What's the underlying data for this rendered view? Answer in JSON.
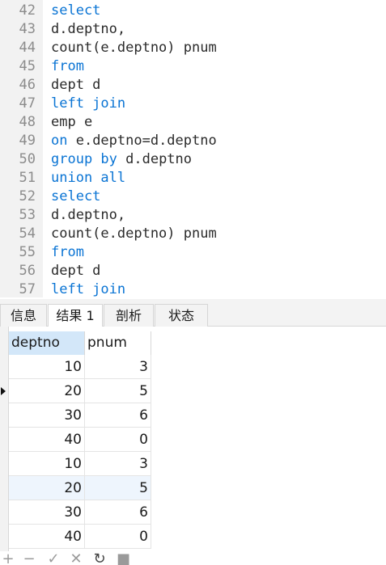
{
  "editor": {
    "lines": [
      {
        "num": "42",
        "text": "select",
        "kind": "kw"
      },
      {
        "num": "43",
        "text": "d.deptno,",
        "kind": "tx"
      },
      {
        "num": "44",
        "text": "count(e.deptno) pnum",
        "kind": "tx"
      },
      {
        "num": "45",
        "text": "from",
        "kind": "kw"
      },
      {
        "num": "46",
        "text": "dept d",
        "kind": "tx"
      },
      {
        "num": "47",
        "text": "left join",
        "kind": "kw"
      },
      {
        "num": "48",
        "text": "emp e",
        "kind": "tx"
      },
      {
        "num": "49",
        "text": "on",
        "rest": " e.deptno=d.deptno",
        "kind": "mixed"
      },
      {
        "num": "50",
        "text": "group by",
        "rest": " d.deptno",
        "kind": "mixed"
      },
      {
        "num": "51",
        "text": "union all",
        "kind": "kw"
      },
      {
        "num": "52",
        "text": "select",
        "kind": "kw"
      },
      {
        "num": "53",
        "text": "d.deptno,",
        "kind": "tx"
      },
      {
        "num": "54",
        "text": "count(e.deptno) pnum",
        "kind": "tx"
      },
      {
        "num": "55",
        "text": "from",
        "kind": "kw"
      },
      {
        "num": "56",
        "text": "dept d",
        "kind": "tx"
      },
      {
        "num": "57",
        "text": "left join",
        "kind": "kw"
      }
    ]
  },
  "tabs": [
    {
      "label": "信息",
      "active": false
    },
    {
      "label": "结果 1",
      "active": true
    },
    {
      "label": "剖析",
      "active": false
    },
    {
      "label": "状态",
      "active": false
    }
  ],
  "grid": {
    "columns": [
      "deptno",
      "pnum"
    ],
    "rows": [
      [
        "10",
        "3"
      ],
      [
        "20",
        "5"
      ],
      [
        "30",
        "6"
      ],
      [
        "40",
        "0"
      ],
      [
        "10",
        "3"
      ],
      [
        "20",
        "5"
      ],
      [
        "30",
        "6"
      ],
      [
        "40",
        "0"
      ]
    ],
    "current_row": 1
  },
  "toolbar": {
    "icons": [
      "plus-icon",
      "minus-icon",
      "check-icon",
      "cross-icon",
      "refresh-icon",
      "stop-icon"
    ]
  },
  "colors": {
    "keyword": "#0a74d4",
    "text": "#2b2b2b",
    "header_selected": "#d3e7f9"
  }
}
